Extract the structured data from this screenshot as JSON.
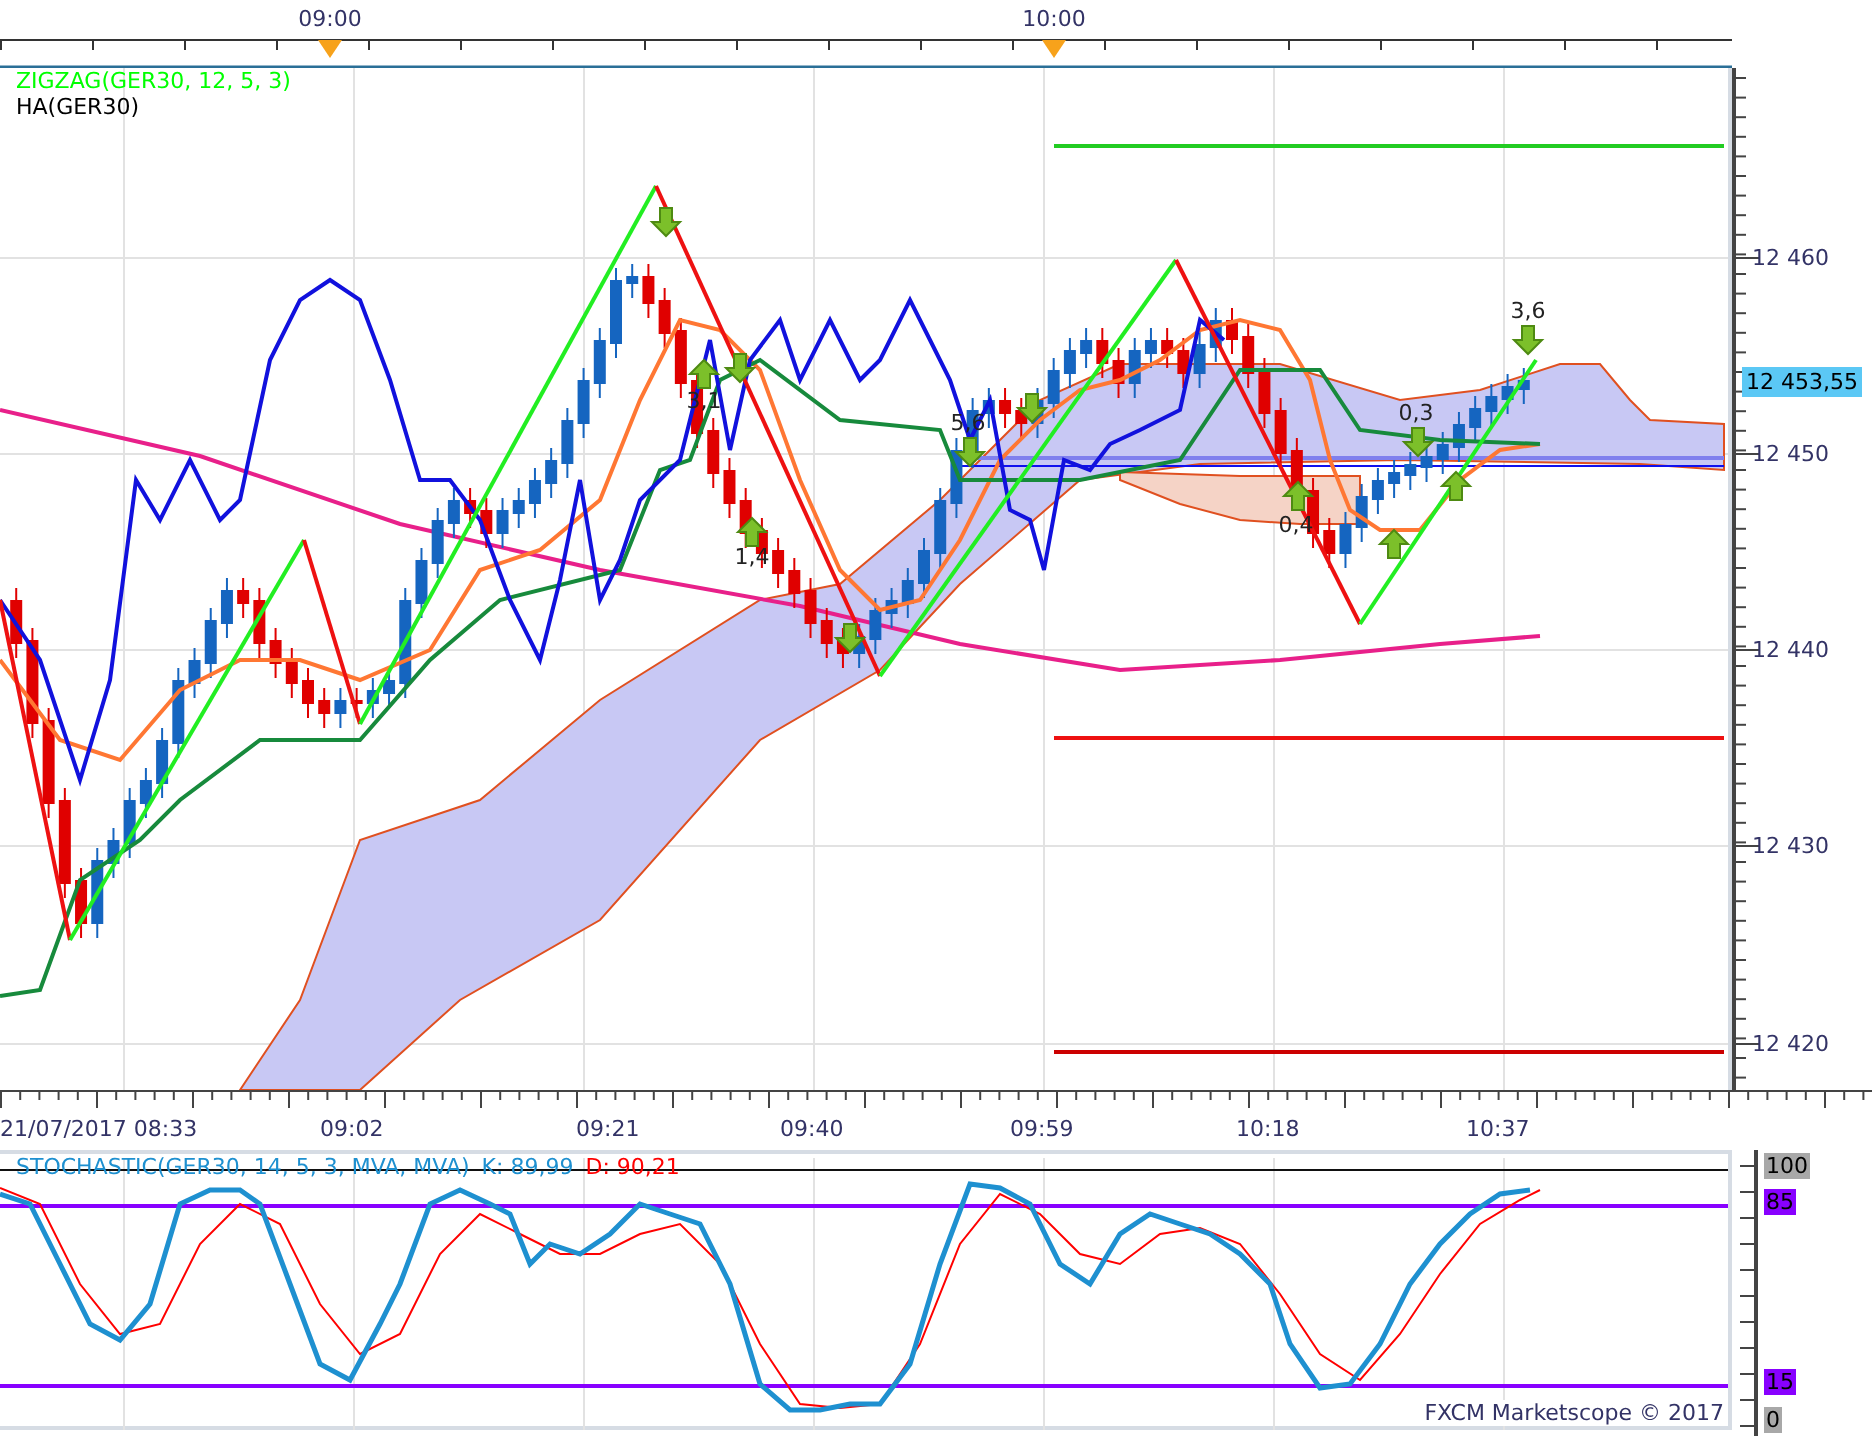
{
  "top_axis": {
    "labels": [
      "09:00",
      "10:00"
    ]
  },
  "price_chart": {
    "legend": [
      {
        "text": "ZIGZAG(GER30, 12, 5, 3)",
        "color": "#00ff00"
      },
      {
        "text": "HA(GER30)",
        "color": "#000000"
      }
    ],
    "signal_labels": [
      "3,1",
      "1,4",
      "5,6",
      "0,4",
      "0,3",
      "3,6"
    ],
    "price_axis": [
      "12 460",
      "12 450",
      "12 440",
      "12 430",
      "12 420"
    ],
    "current_price": "12 453,55"
  },
  "time_axis": {
    "labels": [
      "21/07/2017 08:33",
      "09:02",
      "09:21",
      "09:40",
      "09:59",
      "10:18",
      "10:37"
    ]
  },
  "stochastic": {
    "legend": [
      {
        "text": "STOCHASTIC(GER30, 14, 5, 3, MVA, MVA)",
        "color": "#1e90d0"
      },
      {
        "text": "K: 89,99",
        "color": "#1e90d0"
      },
      {
        "text": "D: 90,21",
        "color": "#ff0000"
      }
    ],
    "axis": [
      {
        "text": "100",
        "kind": "bound"
      },
      {
        "text": "85",
        "kind": "level"
      },
      {
        "text": "15",
        "kind": "level"
      },
      {
        "text": "0",
        "kind": "bound"
      }
    ],
    "footer": "FXCM Marketscope © 2017"
  }
}
